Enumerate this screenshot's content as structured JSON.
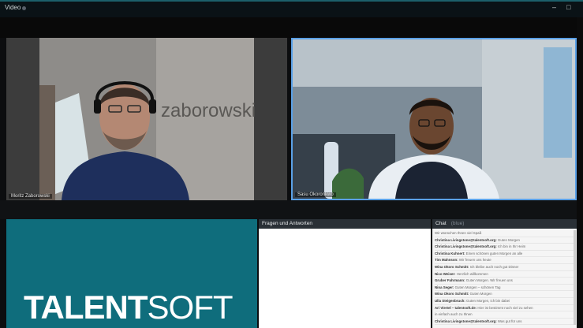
{
  "window": {
    "title": "Video",
    "minimize": "–",
    "maximize": "□"
  },
  "tiles": [
    {
      "name": "Moritz Zaborowski",
      "wall_text": "zaborowski"
    },
    {
      "name": "Sasu Okoronkwo"
    }
  ],
  "brand": {
    "bold": "TALENT",
    "light": "SOFT"
  },
  "qa": {
    "title": "Fragen und Antworten"
  },
  "chat": {
    "title": "Chat",
    "subtitle": "(blue)",
    "messages": [
      {
        "author": "",
        "text": "Wir wünschen Ihnen viel Spaß"
      },
      {
        "author": "Christina Livingstone@talentsoft.org:",
        "text": "Guten Morgen"
      },
      {
        "author": "Christina Livingstone@talentsoft.org:",
        "text": "Ich bin in Ihr Heim"
      },
      {
        "author": "Christina Kuhnert:",
        "text": "Einen schönen guten Morgen an alle"
      },
      {
        "author": "Tim Mahnson:",
        "text": "Wir freuen uns heute"
      },
      {
        "author": "Wina Okoro Schmitt:",
        "text": "Ich bleibe auch noch gut Dinner"
      },
      {
        "author": "Nico Weiser:",
        "text": "Herzlich willkommen"
      },
      {
        "author": "Gruber Fahrmann:",
        "text": "Guten Morgen. Wir freuen uns"
      },
      {
        "author": "Nina Seger:",
        "text": "Guten Morgen – schönen Tag"
      },
      {
        "author": "Wina Okoro Schmitt:",
        "text": "Guten Morgen"
      },
      {
        "author": "Ulla Steigenbruch:",
        "text": "Guten Morgen, ich bin dabei"
      },
      {
        "author": "Ari Viertel – talentsoft.de:",
        "text": "Hier ist bestimmt noch viel zu sehen"
      },
      {
        "author": "",
        "text": "in einfach auch zu Ihnen"
      },
      {
        "author": "Christina Livingstone@talentsoft.org:",
        "text": "Was gut für uns"
      }
    ]
  },
  "colors": {
    "brand_bg": "#0f6d7c",
    "active_border": "#5aa0e6",
    "titlebar_accent": "#1c5f6a"
  }
}
